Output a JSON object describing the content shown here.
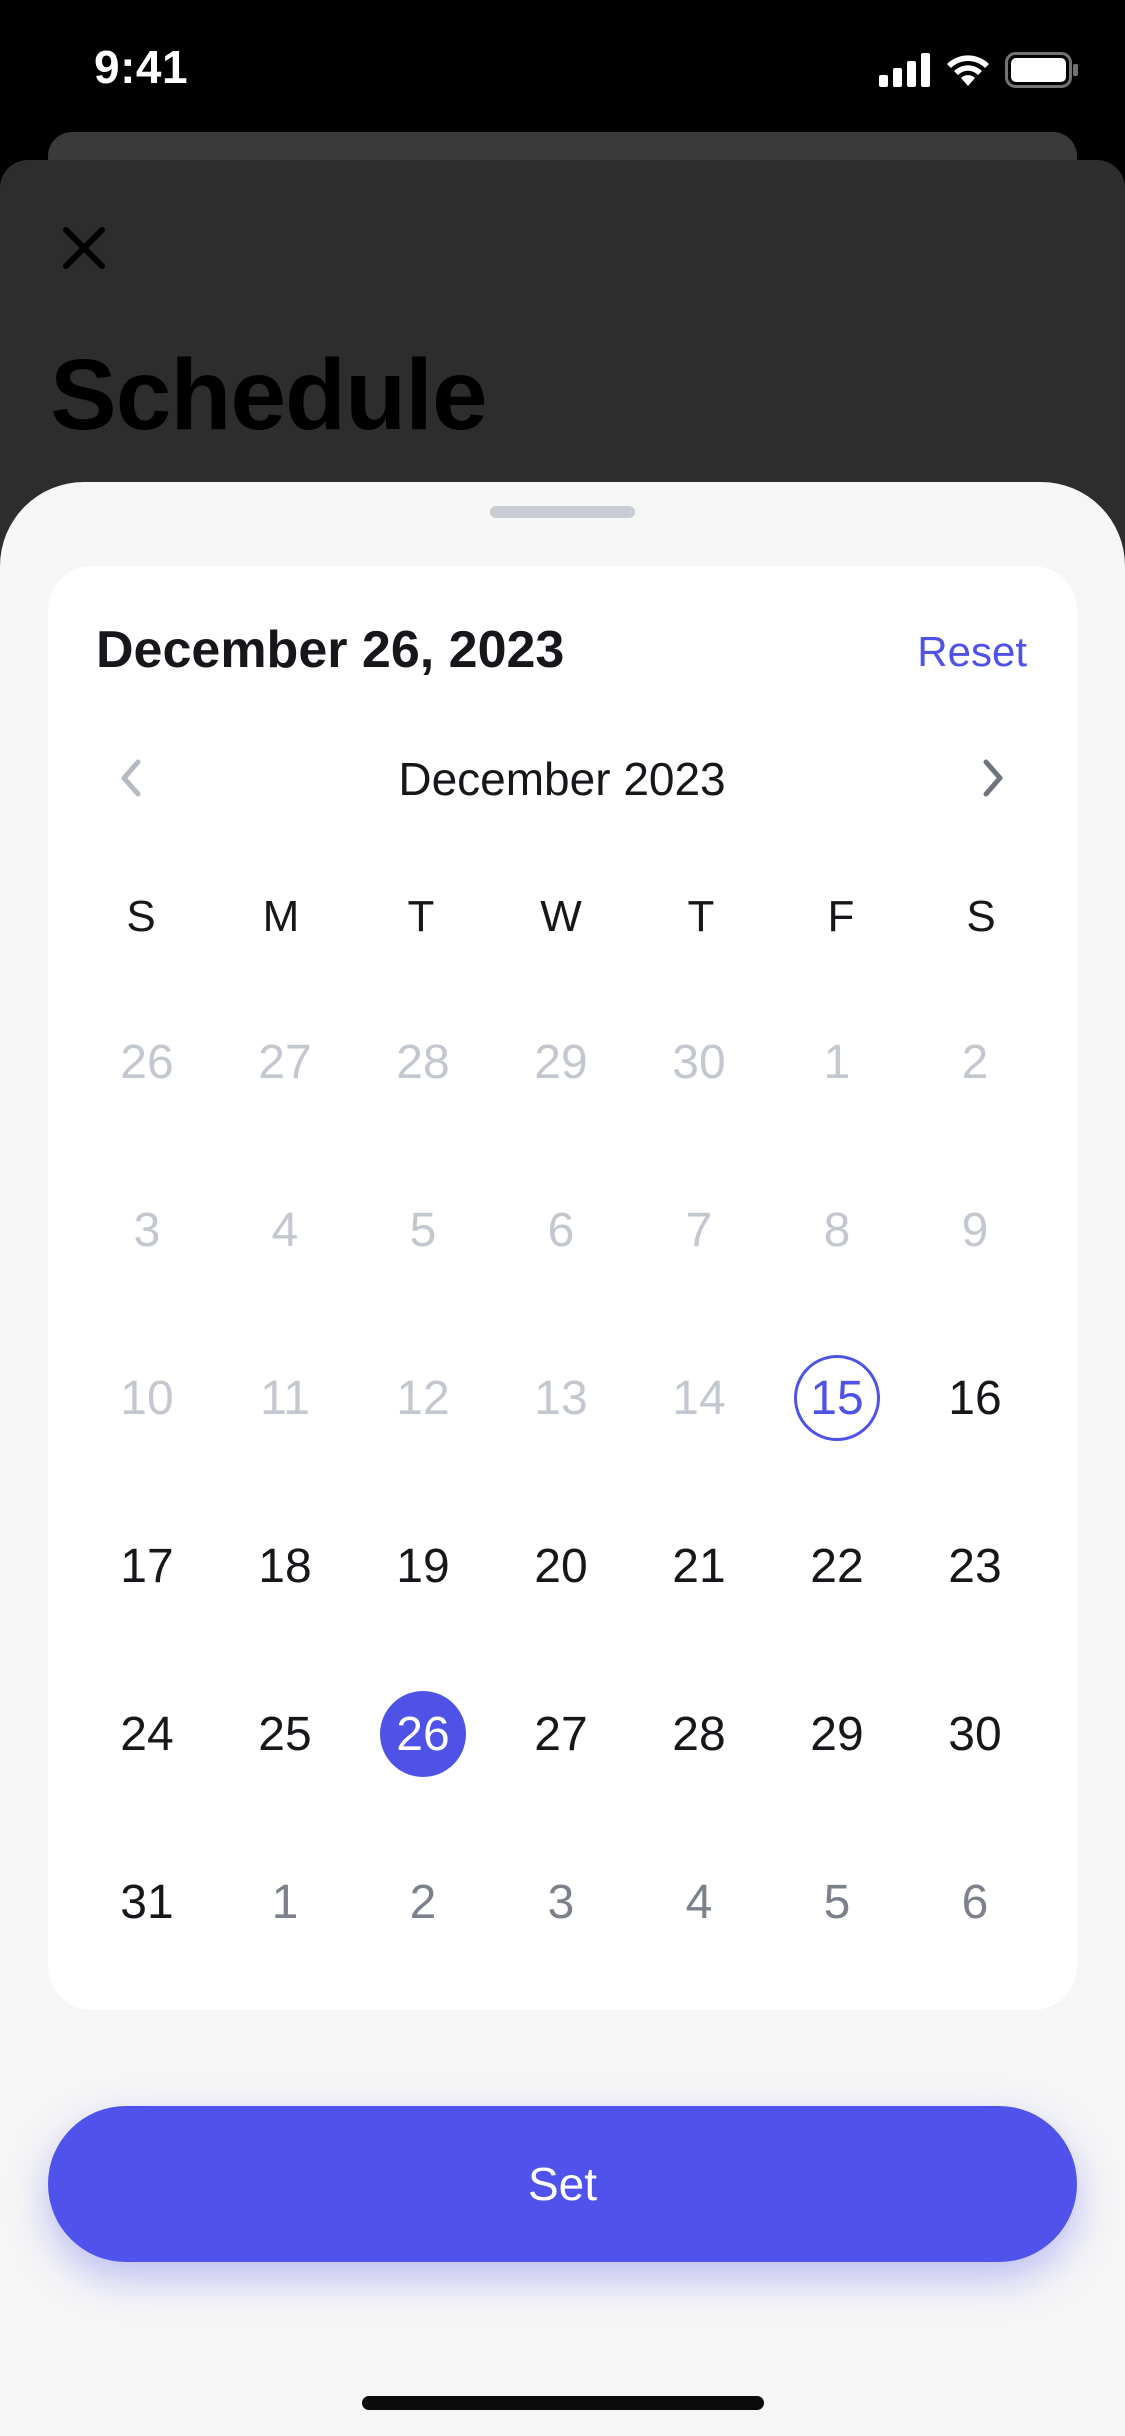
{
  "status_bar": {
    "time": "9:41"
  },
  "screen": {
    "title": "Schedule"
  },
  "date_picker": {
    "selected_date_label": "December 26, 2023",
    "reset_label": "Reset",
    "month_label": "December 2023",
    "weekdays": [
      "S",
      "M",
      "T",
      "W",
      "T",
      "F",
      "S"
    ],
    "weeks": [
      [
        {
          "d": "26",
          "s": "disabled"
        },
        {
          "d": "27",
          "s": "disabled"
        },
        {
          "d": "28",
          "s": "disabled"
        },
        {
          "d": "29",
          "s": "disabled"
        },
        {
          "d": "30",
          "s": "disabled"
        },
        {
          "d": "1",
          "s": "disabled"
        },
        {
          "d": "2",
          "s": "disabled"
        }
      ],
      [
        {
          "d": "3",
          "s": "disabled"
        },
        {
          "d": "4",
          "s": "disabled"
        },
        {
          "d": "5",
          "s": "disabled"
        },
        {
          "d": "6",
          "s": "disabled"
        },
        {
          "d": "7",
          "s": "disabled"
        },
        {
          "d": "8",
          "s": "disabled"
        },
        {
          "d": "9",
          "s": "disabled"
        }
      ],
      [
        {
          "d": "10",
          "s": "disabled"
        },
        {
          "d": "11",
          "s": "disabled"
        },
        {
          "d": "12",
          "s": "disabled"
        },
        {
          "d": "13",
          "s": "disabled"
        },
        {
          "d": "14",
          "s": "disabled"
        },
        {
          "d": "15",
          "s": "today"
        },
        {
          "d": "16",
          "s": "active"
        }
      ],
      [
        {
          "d": "17",
          "s": "active"
        },
        {
          "d": "18",
          "s": "active"
        },
        {
          "d": "19",
          "s": "active"
        },
        {
          "d": "20",
          "s": "active"
        },
        {
          "d": "21",
          "s": "active"
        },
        {
          "d": "22",
          "s": "active"
        },
        {
          "d": "23",
          "s": "active"
        }
      ],
      [
        {
          "d": "24",
          "s": "active"
        },
        {
          "d": "25",
          "s": "active"
        },
        {
          "d": "26",
          "s": "selected"
        },
        {
          "d": "27",
          "s": "active"
        },
        {
          "d": "28",
          "s": "active"
        },
        {
          "d": "29",
          "s": "active"
        },
        {
          "d": "30",
          "s": "active"
        }
      ],
      [
        {
          "d": "31",
          "s": "active"
        },
        {
          "d": "1",
          "s": "outside"
        },
        {
          "d": "2",
          "s": "outside"
        },
        {
          "d": "3",
          "s": "outside"
        },
        {
          "d": "4",
          "s": "outside"
        },
        {
          "d": "5",
          "s": "outside"
        },
        {
          "d": "6",
          "s": "outside"
        }
      ]
    ]
  },
  "action": {
    "set_label": "Set"
  },
  "colors": {
    "accent": "#5053eb",
    "disabled_text": "#c3c7cf",
    "outside_text": "#7c818c"
  }
}
